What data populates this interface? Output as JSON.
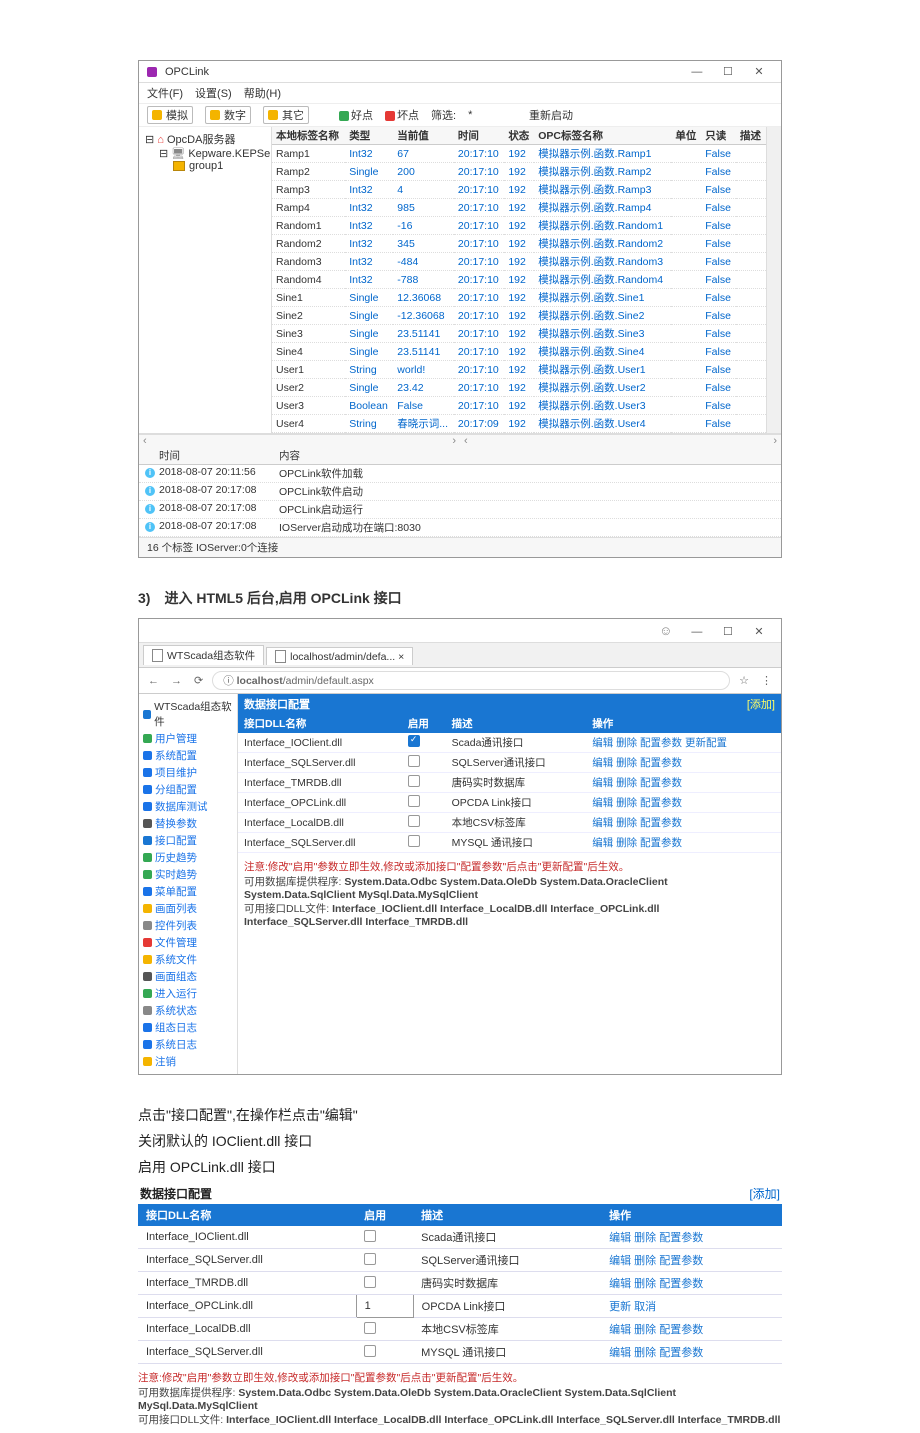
{
  "opclink": {
    "title": "OPCLink",
    "menu": [
      "文件(F)",
      "设置(S)",
      "帮助(H)"
    ],
    "toolbar": {
      "sim": "模拟",
      "num": "数字",
      "other": "其它",
      "good": "好点",
      "bad": "坏点",
      "filter": "筛选:",
      "star": "*",
      "restart": "重新启动"
    },
    "tree": {
      "root": "OpcDA服务器",
      "n1": "Kepware.KEPServerEX",
      "n2": "group1"
    },
    "cols": [
      "本地标签名称",
      "类型",
      "当前值",
      "时间",
      "状态",
      "OPC标签名称",
      "单位",
      "只读",
      "描述"
    ],
    "rows": [
      {
        "n": "Ramp1",
        "t": "Int32",
        "v": "67",
        "tm": "20:17:10",
        "st": "192",
        "opc": "模拟器示例.函数.Ramp1",
        "u": "",
        "ro": "False",
        "d": ""
      },
      {
        "n": "Ramp2",
        "t": "Single",
        "v": "200",
        "tm": "20:17:10",
        "st": "192",
        "opc": "模拟器示例.函数.Ramp2",
        "u": "",
        "ro": "False",
        "d": ""
      },
      {
        "n": "Ramp3",
        "t": "Int32",
        "v": "4",
        "tm": "20:17:10",
        "st": "192",
        "opc": "模拟器示例.函数.Ramp3",
        "u": "",
        "ro": "False",
        "d": ""
      },
      {
        "n": "Ramp4",
        "t": "Int32",
        "v": "985",
        "tm": "20:17:10",
        "st": "192",
        "opc": "模拟器示例.函数.Ramp4",
        "u": "",
        "ro": "False",
        "d": ""
      },
      {
        "n": "Random1",
        "t": "Int32",
        "v": "-16",
        "tm": "20:17:10",
        "st": "192",
        "opc": "模拟器示例.函数.Random1",
        "u": "",
        "ro": "False",
        "d": ""
      },
      {
        "n": "Random2",
        "t": "Int32",
        "v": "345",
        "tm": "20:17:10",
        "st": "192",
        "opc": "模拟器示例.函数.Random2",
        "u": "",
        "ro": "False",
        "d": ""
      },
      {
        "n": "Random3",
        "t": "Int32",
        "v": "-484",
        "tm": "20:17:10",
        "st": "192",
        "opc": "模拟器示例.函数.Random3",
        "u": "",
        "ro": "False",
        "d": ""
      },
      {
        "n": "Random4",
        "t": "Int32",
        "v": "-788",
        "tm": "20:17:10",
        "st": "192",
        "opc": "模拟器示例.函数.Random4",
        "u": "",
        "ro": "False",
        "d": ""
      },
      {
        "n": "Sine1",
        "t": "Single",
        "v": "12.36068",
        "tm": "20:17:10",
        "st": "192",
        "opc": "模拟器示例.函数.Sine1",
        "u": "",
        "ro": "False",
        "d": ""
      },
      {
        "n": "Sine2",
        "t": "Single",
        "v": "-12.36068",
        "tm": "20:17:10",
        "st": "192",
        "opc": "模拟器示例.函数.Sine2",
        "u": "",
        "ro": "False",
        "d": ""
      },
      {
        "n": "Sine3",
        "t": "Single",
        "v": "23.51141",
        "tm": "20:17:10",
        "st": "192",
        "opc": "模拟器示例.函数.Sine3",
        "u": "",
        "ro": "False",
        "d": ""
      },
      {
        "n": "Sine4",
        "t": "Single",
        "v": "23.51141",
        "tm": "20:17:10",
        "st": "192",
        "opc": "模拟器示例.函数.Sine4",
        "u": "",
        "ro": "False",
        "d": ""
      },
      {
        "n": "User1",
        "t": "String",
        "v": "world!",
        "tm": "20:17:10",
        "st": "192",
        "opc": "模拟器示例.函数.User1",
        "u": "",
        "ro": "False",
        "d": ""
      },
      {
        "n": "User2",
        "t": "Single",
        "v": "23.42",
        "tm": "20:17:10",
        "st": "192",
        "opc": "模拟器示例.函数.User2",
        "u": "",
        "ro": "False",
        "d": ""
      },
      {
        "n": "User3",
        "t": "Boolean",
        "v": "False",
        "tm": "20:17:10",
        "st": "192",
        "opc": "模拟器示例.函数.User3",
        "u": "",
        "ro": "False",
        "d": ""
      },
      {
        "n": "User4",
        "t": "String",
        "v": "春晓示词...",
        "tm": "20:17:09",
        "st": "192",
        "opc": "模拟器示例.函数.User4",
        "u": "",
        "ro": "False",
        "d": ""
      }
    ],
    "log_cols": [
      "时间",
      "内容"
    ],
    "log": [
      {
        "t": "2018-08-07 20:11:56",
        "m": "OPCLink软件加载"
      },
      {
        "t": "2018-08-07 20:17:08",
        "m": "OPCLink软件启动"
      },
      {
        "t": "2018-08-07 20:17:08",
        "m": "OPCLink启动运行"
      },
      {
        "t": "2018-08-07 20:17:08",
        "m": "IOServer启动成功在端口:8030"
      }
    ],
    "status": "16 个标签  IOServer:0个连接"
  },
  "step_title": "3)　进入 HTML5 后台,启用 OPCLink 接口",
  "browser": {
    "tabs": [
      "WTScada组态软件",
      "localhost/admin/defa... ×"
    ],
    "url_prefix": "localhost",
    "url_suffix": "/admin/default.aspx",
    "url_info": "ⓘ",
    "sidebar_title": "WTScada组态软件",
    "sidebar": [
      {
        "l": "用户管理",
        "c": "#34a853"
      },
      {
        "l": "系统配置",
        "c": "#1a73e8"
      },
      {
        "l": "项目维护",
        "c": "#1a73e8"
      },
      {
        "l": "分组配置",
        "c": "#1a73e8"
      },
      {
        "l": "数据库测试",
        "c": "#1a73e8"
      },
      {
        "l": "替换参数",
        "c": "#555"
      },
      {
        "l": "接口配置",
        "c": "#1976d2"
      },
      {
        "l": "历史趋势",
        "c": "#34a853"
      },
      {
        "l": "实时趋势",
        "c": "#34a853"
      },
      {
        "l": "菜单配置",
        "c": "#1a73e8"
      },
      {
        "l": "画面列表",
        "c": "#f4b400"
      },
      {
        "l": "控件列表",
        "c": "#888"
      },
      {
        "l": "文件管理",
        "c": "#e53935"
      },
      {
        "l": "系统文件",
        "c": "#f4b400"
      },
      {
        "l": "画面组态",
        "c": "#555"
      },
      {
        "l": "进入运行",
        "c": "#34a853"
      },
      {
        "l": "系统状态",
        "c": "#888"
      },
      {
        "l": "组态日志",
        "c": "#1a73e8"
      },
      {
        "l": "系统日志",
        "c": "#1a73e8"
      },
      {
        "l": "注销",
        "c": "#f4b400"
      }
    ],
    "panel_title": "数据接口配置",
    "add_label": "[添加]",
    "cols": [
      "接口DLL名称",
      "启用",
      "描述",
      "操作"
    ],
    "rows": [
      {
        "dll": "Interface_IOClient.dll",
        "en": true,
        "desc": "Scada通讯接口",
        "act": "编辑  删除    配置参数  更新配置"
      },
      {
        "dll": "Interface_SQLServer.dll",
        "en": false,
        "desc": "SQLServer通讯接口",
        "act": "编辑  删除    配置参数"
      },
      {
        "dll": "Interface_TMRDB.dll",
        "en": false,
        "desc": "唐码实时数据库",
        "act": "编辑  删除    配置参数"
      },
      {
        "dll": "Interface_OPCLink.dll",
        "en": false,
        "desc": "OPCDA Link接口",
        "act": "编辑  删除    配置参数"
      },
      {
        "dll": "Interface_LocalDB.dll",
        "en": false,
        "desc": "本地CSV标签库",
        "act": "编辑  删除    配置参数"
      },
      {
        "dll": "Interface_SQLServer.dll",
        "en": false,
        "desc": "MYSQL 通讯接口",
        "act": "编辑  删除    配置参数"
      }
    ],
    "notes": [
      "注意:修改\"启用\"参数立即生效,修改或添加接口\"配置参数\"后点击\"更新配置\"后生效。",
      "可用数据库提供程序:  System.Data.Odbc  System.Data.OleDb  System.Data.OracleClient  System.Data.SqlClient  MySql.Data.MySqlClient",
      "可用接口DLL文件:  Interface_IOClient.dll  Interface_LocalDB.dll  Interface_OPCLink.dll  Interface_SQLServer.dll  Interface_TMRDB.dll"
    ]
  },
  "body_text": [
    "点击\"接口配置\",在操作栏点击\"编辑\"",
    "关闭默认的  IOClient.dll 接口",
    "启用 OPCLink.dll 接口"
  ],
  "table3": {
    "panel_title": "数据接口配置",
    "add_label": "[添加]",
    "cols": [
      "接口DLL名称",
      "启用",
      "描述",
      "操作"
    ],
    "rows": [
      {
        "dll": "Interface_IOClient.dll",
        "en": "0",
        "desc": "Scada通讯接口",
        "act": "编辑  删除    配置参数"
      },
      {
        "dll": "Interface_SQLServer.dll",
        "en": "0",
        "desc": "SQLServer通讯接口",
        "act": "编辑  删除    配置参数"
      },
      {
        "dll": "Interface_TMRDB.dll",
        "en": "0",
        "desc": "唐码实时数据库",
        "act": "编辑  删除    配置参数"
      },
      {
        "dll": "Interface_OPCLink.dll",
        "en": "1",
        "desc": "OPCDA Link接口",
        "act": "更新  取消"
      },
      {
        "dll": "Interface_LocalDB.dll",
        "en": "0",
        "desc": "本地CSV标签库",
        "act": "编辑  删除    配置参数"
      },
      {
        "dll": "Interface_SQLServer.dll",
        "en": "0",
        "desc": "MYSQL 通讯接口",
        "act": "编辑  删除    配置参数"
      }
    ],
    "notes": [
      "注意:修改\"启用\"参数立即生效,修改或添加接口\"配置参数\"后点击\"更新配置\"后生效。",
      "可用数据库提供程序:  System.Data.Odbc  System.Data.OleDb  System.Data.OracleClient  System.Data.SqlClient  MySql.Data.MySqlClient",
      "可用接口DLL文件:  Interface_IOClient.dll  Interface_LocalDB.dll  Interface_OPCLink.dll  Interface_SQLServer.dll  Interface_TMRDB.dll"
    ]
  }
}
